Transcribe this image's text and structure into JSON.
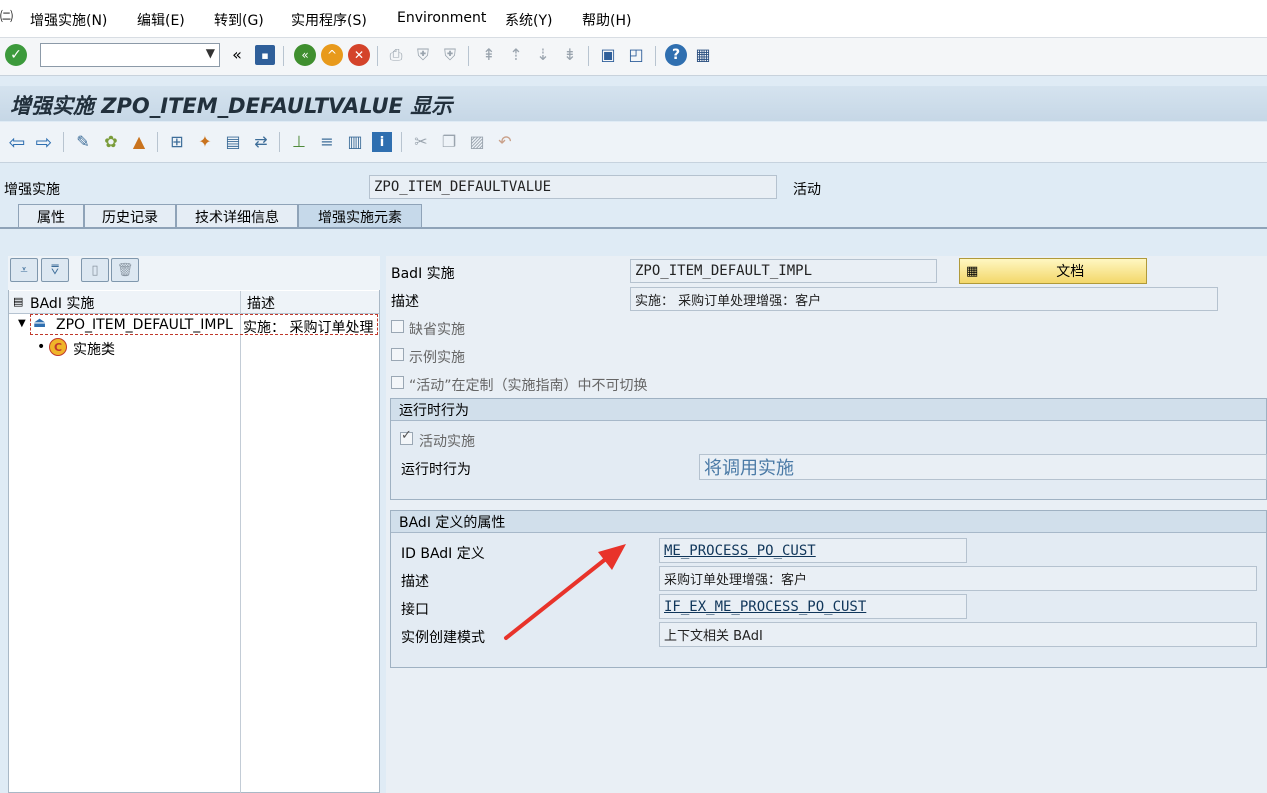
{
  "menubar": {
    "items": [
      "增强实施(N)",
      "编辑(E)",
      "转到(G)",
      "实用程序(S)",
      "Environment",
      "系统(Y)",
      "帮助(H)"
    ]
  },
  "systoolbar": {
    "command_field_value": "",
    "icons": [
      "enter-icon",
      "save-icon",
      "back-icon",
      "exit-icon",
      "cancel-icon",
      "print-icon",
      "find-icon",
      "find-next-icon",
      "first-page-icon",
      "prev-page-icon",
      "next-page-icon",
      "last-page-icon",
      "new-session-icon",
      "shortcut-icon",
      "help-icon",
      "layout-icon"
    ]
  },
  "title": "增强实施 ZPO_ITEM_DEFAULTVALUE 显示",
  "header": {
    "label": "增强实施",
    "value": "ZPO_ITEM_DEFAULTVALUE",
    "status": "活动"
  },
  "tabs": [
    {
      "label": "属性"
    },
    {
      "label": "历史记录"
    },
    {
      "label": "技术详细信息"
    },
    {
      "label": "增强实施元素"
    }
  ],
  "tree": {
    "col1": "BAdI 实施",
    "col2": "描述",
    "node1_label": "ZPO_ITEM_DEFAULT_IMPL",
    "node1_desc": "实施： 采购订单处理",
    "node2_label": "实施类"
  },
  "detail": {
    "badi_impl_label": "BadI 实施",
    "badi_impl_value": "ZPO_ITEM_DEFAULT_IMPL",
    "doc_button": "文档",
    "desc_label": "描述",
    "desc_value": "实施： 采购订单处理增强：客户",
    "cb_default": "缺省实施",
    "cb_example": "示例实施",
    "cb_active_switch": "“活动”在定制（实施指南）中不可切换",
    "runtime_group_title": "运行时行为",
    "cb_active_impl": "活动实施",
    "runtime_label": "运行时行为",
    "runtime_value": "将调用实施",
    "badi_group_title": "BAdI 定义的属性",
    "id_label": "ID BAdI 定义",
    "id_value": "ME_PROCESS_PO_CUST",
    "def_desc_label": "描述",
    "def_desc_value": "采购订单处理增强：客户",
    "interface_label": "接口",
    "interface_value": "IF_EX_ME_PROCESS_PO_CUST",
    "instance_label": "实例创建模式",
    "instance_value": "上下文相关 BAdI"
  }
}
